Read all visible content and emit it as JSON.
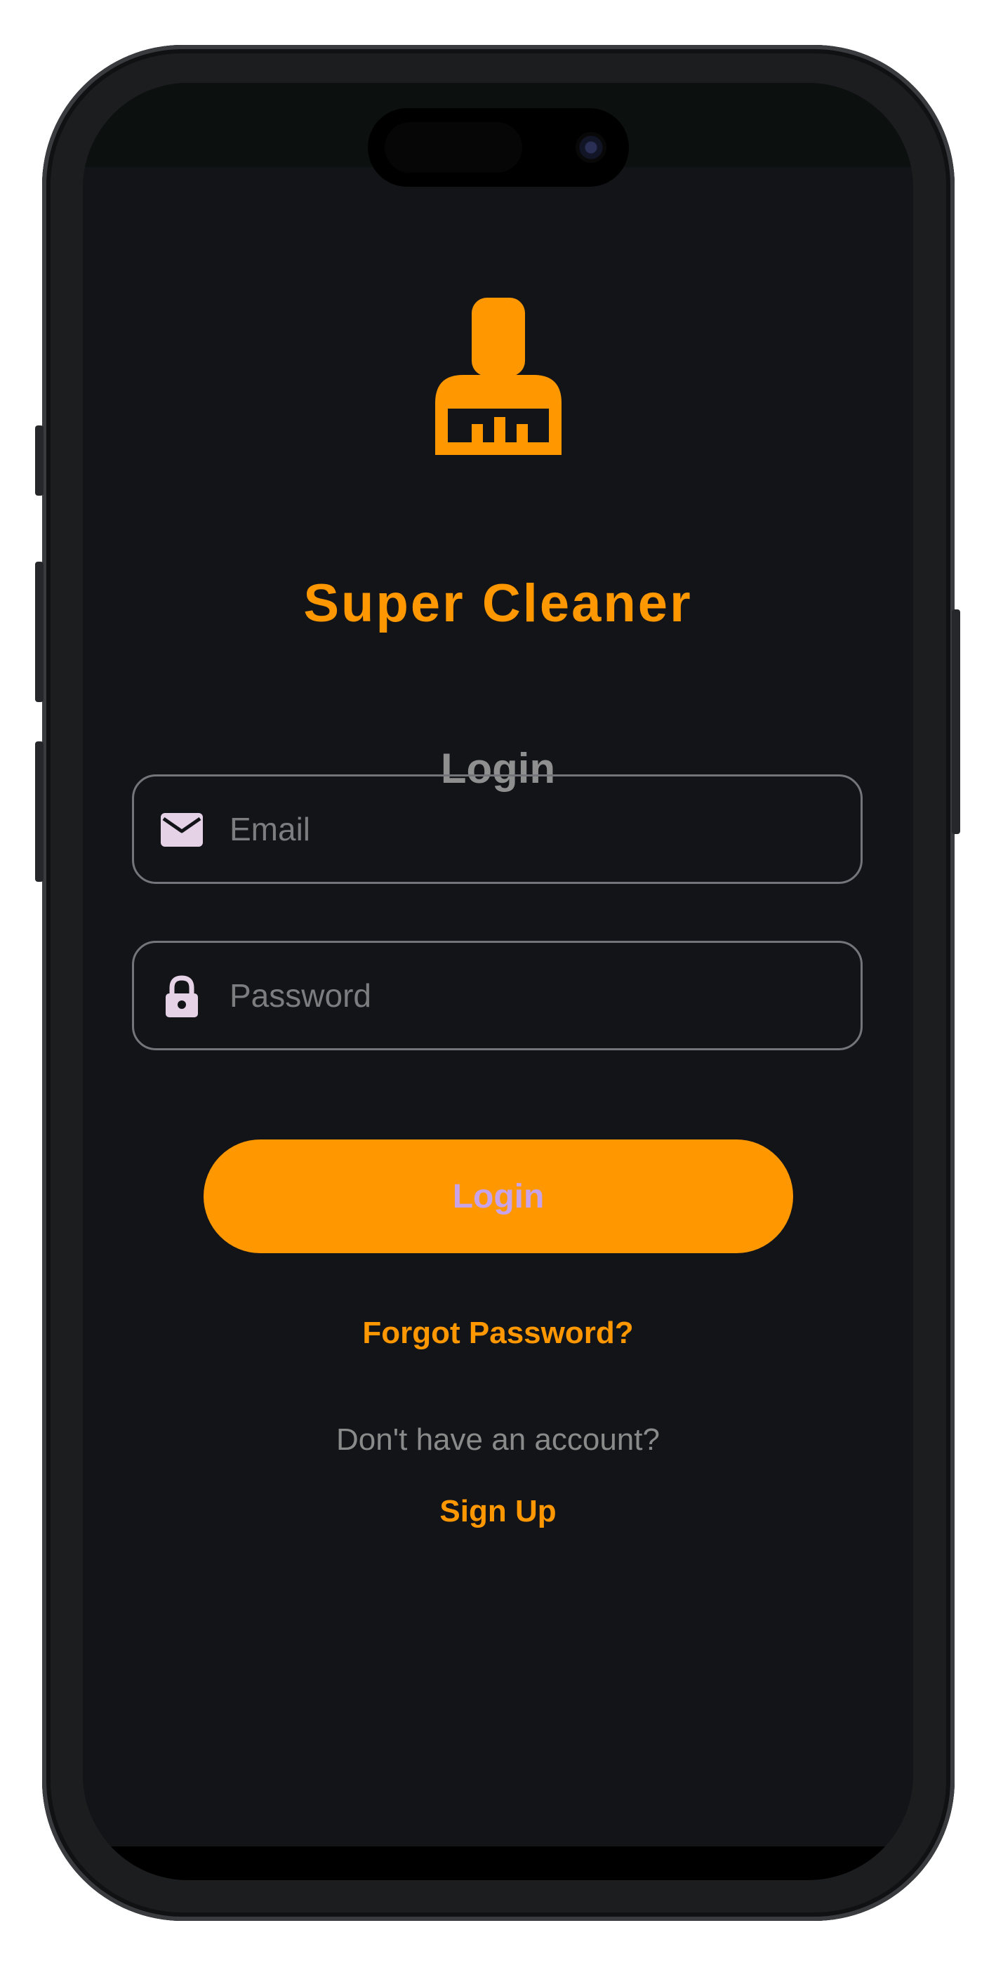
{
  "app": {
    "title": "Super Cleaner",
    "logo_icon": "broom-icon",
    "accent_color": "#ff9800",
    "background_color": "#121418"
  },
  "login_form": {
    "heading": "Login",
    "email": {
      "icon": "mail-icon",
      "placeholder": "Email",
      "value": ""
    },
    "password": {
      "icon": "lock-icon",
      "placeholder": "Password",
      "value": ""
    },
    "submit_label": "Login",
    "forgot_password_label": "Forgot Password?",
    "no_account_text": "Don't have an account?",
    "sign_up_label": "Sign Up"
  }
}
